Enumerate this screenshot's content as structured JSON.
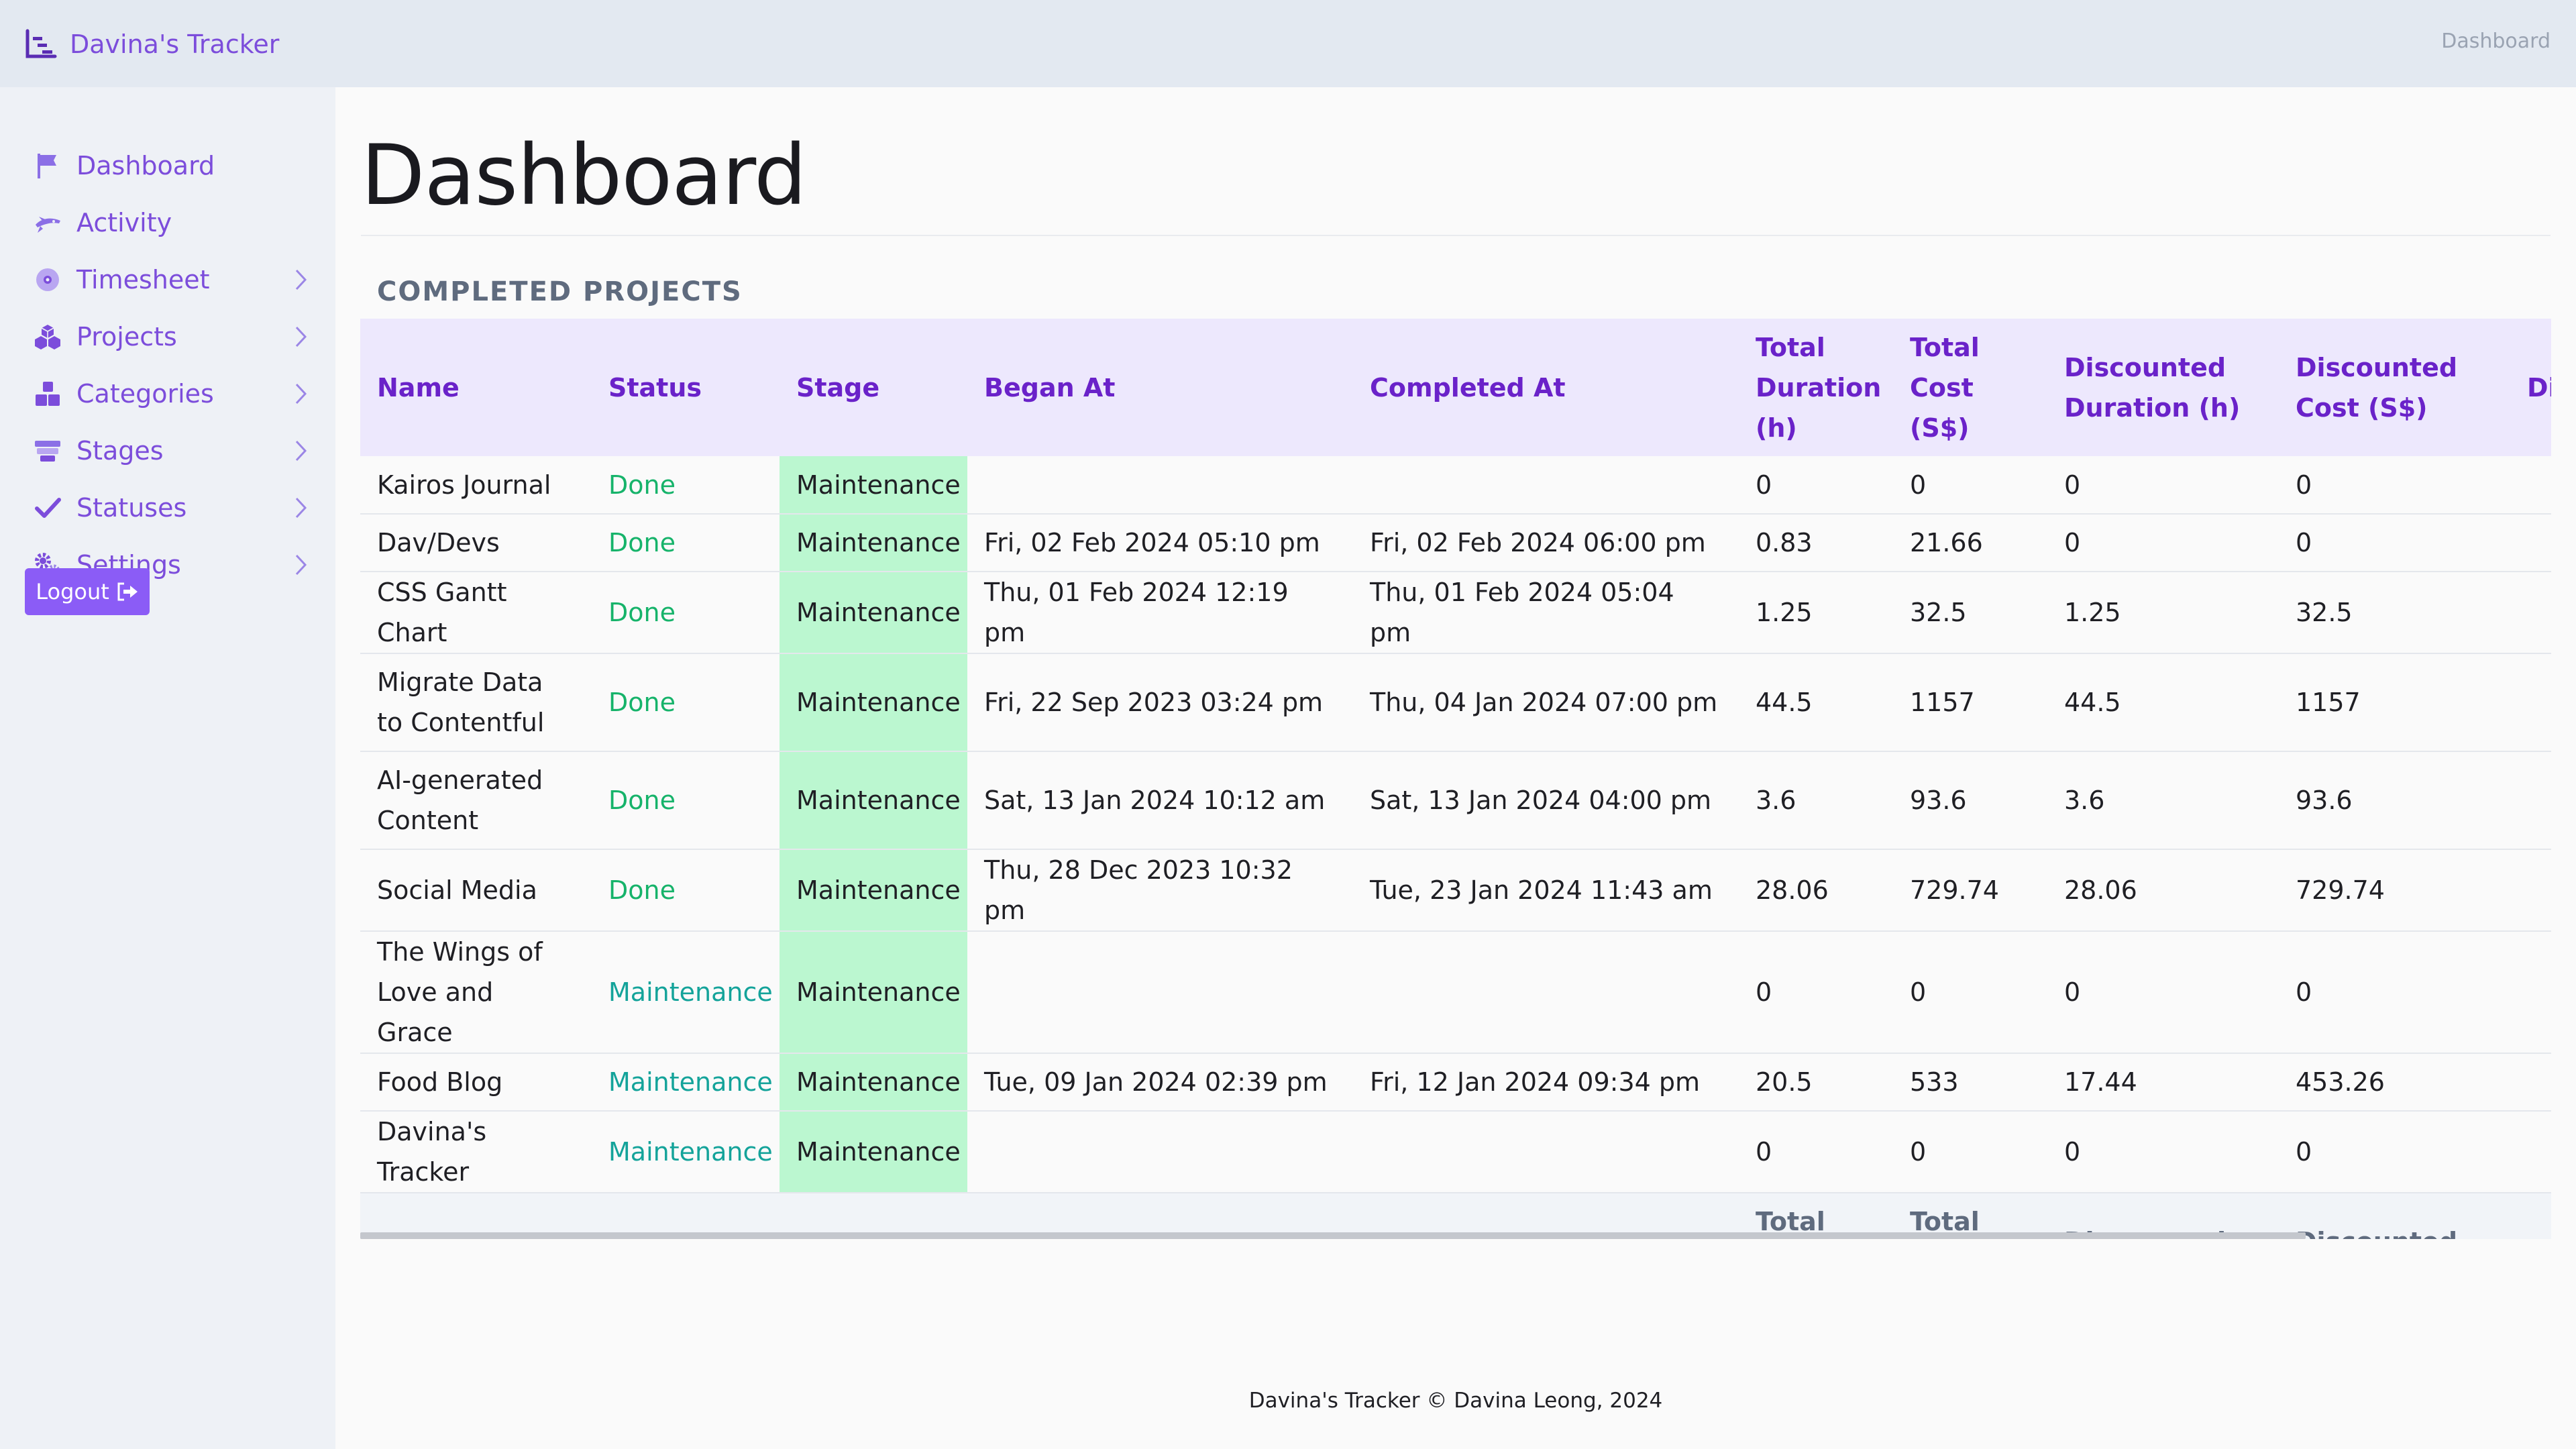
{
  "app": {
    "brand": "Davina's Tracker"
  },
  "header": {
    "right_link": "Dashboard"
  },
  "sidebar": {
    "items": [
      {
        "label": "Dashboard",
        "icon": "flag-icon",
        "has_chevron": false
      },
      {
        "label": "Activity",
        "icon": "shuttle-icon",
        "has_chevron": false
      },
      {
        "label": "Timesheet",
        "icon": "disc-icon",
        "has_chevron": true
      },
      {
        "label": "Projects",
        "icon": "cubes-icon",
        "has_chevron": true
      },
      {
        "label": "Categories",
        "icon": "boxes-icon",
        "has_chevron": true
      },
      {
        "label": "Stages",
        "icon": "stages-icon",
        "has_chevron": true
      },
      {
        "label": "Statuses",
        "icon": "check-icon",
        "has_chevron": true
      },
      {
        "label": "Settings",
        "icon": "gears-icon",
        "has_chevron": true
      }
    ],
    "logout_label": "Logout"
  },
  "main": {
    "title": "Dashboard",
    "section_title": "COMPLETED PROJECTS",
    "table": {
      "headers": [
        "Name",
        "Status",
        "Stage",
        "Began At",
        "Completed At",
        "Total Duration (h)",
        "Total Cost (S$)",
        "Discounted Duration (h)",
        "Discounted Cost (S$)",
        "Di"
      ],
      "rows": [
        [
          "Kairos Journal",
          "Done",
          "Maintenance",
          "",
          "",
          "0",
          "0",
          "0",
          "0",
          ""
        ],
        [
          "Dav/Devs",
          "Done",
          "Maintenance",
          "Fri, 02 Feb 2024 05:10 pm",
          "Fri, 02 Feb 2024 06:00 pm",
          "0.83",
          "21.66",
          "0",
          "0",
          ""
        ],
        [
          "CSS Gantt Chart",
          "Done",
          "Maintenance",
          "Thu, 01 Feb 2024 12:19 pm",
          "Thu, 01 Feb 2024 05:04 pm",
          "1.25",
          "32.5",
          "1.25",
          "32.5",
          ""
        ],
        [
          "Migrate Data to Contentful",
          "Done",
          "Maintenance",
          "Fri, 22 Sep 2023 03:24 pm",
          "Thu, 04 Jan 2024 07:00 pm",
          "44.5",
          "1157",
          "44.5",
          "1157",
          ""
        ],
        [
          "AI-generated Content",
          "Done",
          "Maintenance",
          "Sat, 13 Jan 2024 10:12 am",
          "Sat, 13 Jan 2024 04:00 pm",
          "3.6",
          "93.6",
          "3.6",
          "93.6",
          ""
        ],
        [
          "Social Media",
          "Done",
          "Maintenance",
          "Thu, 28 Dec 2023 10:32 pm",
          "Tue, 23 Jan 2024 11:43 am",
          "28.06",
          "729.74",
          "28.06",
          "729.74",
          ""
        ],
        [
          "The Wings of Love and Grace",
          "Maintenance",
          "Maintenance",
          "",
          "",
          "0",
          "0",
          "0",
          "0",
          ""
        ],
        [
          "Food Blog",
          "Maintenance",
          "Maintenance",
          "Tue, 09 Jan 2024 02:39 pm",
          "Fri, 12 Jan 2024 09:34 pm",
          "20.5",
          "533",
          "17.44",
          "453.26",
          ""
        ],
        [
          "Davina's Tracker",
          "Maintenance",
          "Maintenance",
          "",
          "",
          "0",
          "0",
          "0",
          "0",
          ""
        ]
      ]
    }
  },
  "footer": {
    "text": "Davina's Tracker © Davina Leong, 2024"
  },
  "colors": {
    "accent": "#7c4ddb",
    "logout_bg": "#8b5cf6",
    "header_bg": "#ede8fd",
    "stage_bg": "#bbf7d0",
    "status_done": "#16b36a",
    "status_maintenance": "#14a39a"
  }
}
